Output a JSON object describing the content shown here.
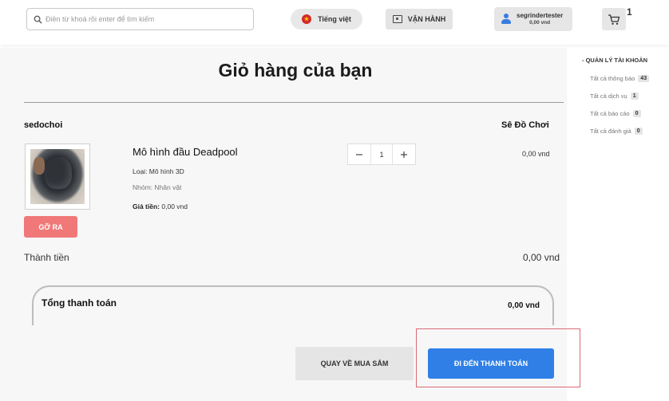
{
  "header": {
    "search_placeholder": "Điền từ khoá rồi enter để tìm kiếm",
    "language_label": "Tiếng việt",
    "operate_label": "VẬN HÀNH",
    "user": {
      "name": "segrindertester",
      "balance": "0,00 vnd"
    },
    "cart_count": "1"
  },
  "cart": {
    "title": "Giỏ hàng của bạn",
    "shop_owner": "sedochoi",
    "shop_name": "Sê Đồ Chơi",
    "item": {
      "name": "Mô hình đầu Deadpool",
      "type_line": "Loại: Mô hình 3D",
      "group_line": "Nhóm: Nhân vật",
      "price_label": "Giá tiền:",
      "price_value": "0,00 vnd",
      "quantity": "1",
      "line_total": "0,00 vnd",
      "remove_label": "GỠ RA"
    },
    "subtotal_label": "Thành tiền",
    "subtotal_value": "0,00 vnd",
    "total_label": "Tổng thanh toán",
    "total_value": "0,00 vnd",
    "continue_label": "QUAY VỀ MUA SẮM",
    "checkout_label": "ĐI ĐẾN THANH TOÁN"
  },
  "sidebar": {
    "title": "- QUẢN LÝ TÀI KHOẢN",
    "items": [
      {
        "label": "Tất cả thông báo",
        "count": "43"
      },
      {
        "label": "Tất cả dịch vụ",
        "count": "1"
      },
      {
        "label": "Tất cả báo cáo",
        "count": "0"
      },
      {
        "label": "Tất cả đánh giá",
        "count": "0"
      }
    ]
  },
  "colors": {
    "accent": "#2f7fe6",
    "remove": "#f07878",
    "highlight_border": "#d86a75"
  }
}
